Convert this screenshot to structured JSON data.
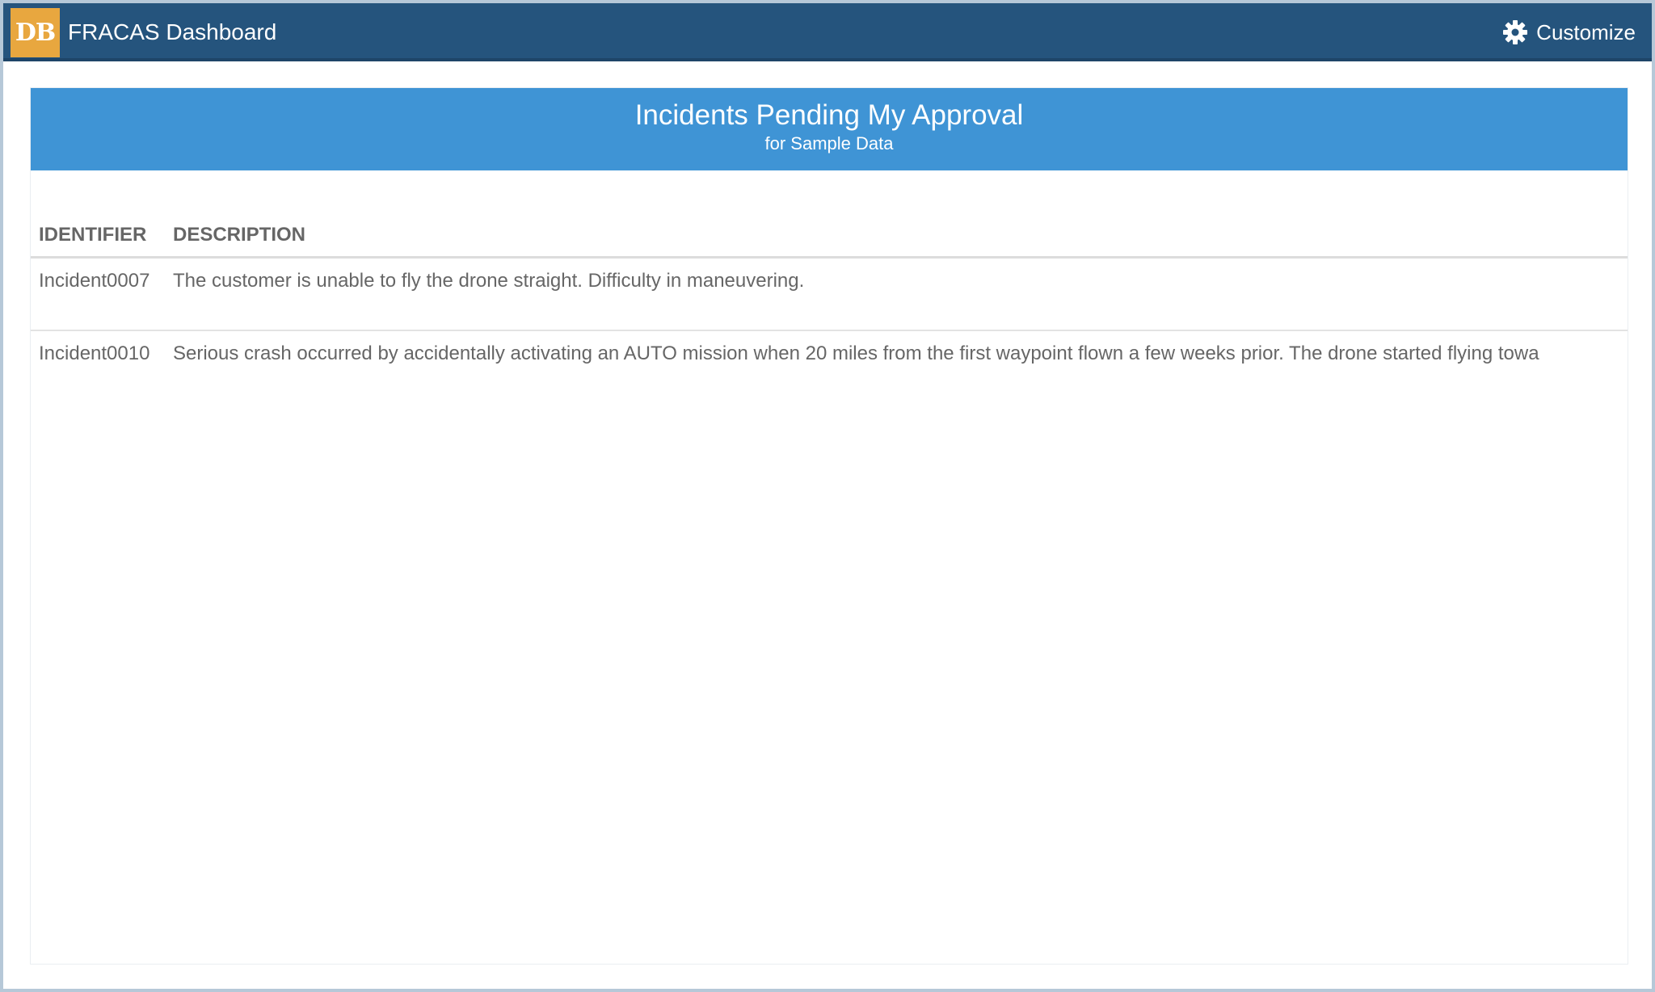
{
  "app": {
    "logo_text": "DB",
    "title": "FRACAS Dashboard",
    "customize_label": "Customize"
  },
  "panel": {
    "title": "Incidents Pending My Approval",
    "subtitle": "for Sample Data",
    "columns": [
      "IDENTIFIER",
      "DESCRIPTION"
    ],
    "rows": [
      {
        "identifier": "Incident0007",
        "description": "The customer is unable to fly the drone straight. Difficulty in maneuvering."
      },
      {
        "identifier": "Incident0010",
        "description": "Serious crash occurred by accidentally activating an AUTO mission when 20 miles from the first waypoint flown a few weeks prior. The drone started flying towa"
      }
    ]
  },
  "colors": {
    "topbar": "#25547d",
    "logo": "#e8a73f",
    "panel_header": "#3f94d5",
    "text": "#666666"
  }
}
